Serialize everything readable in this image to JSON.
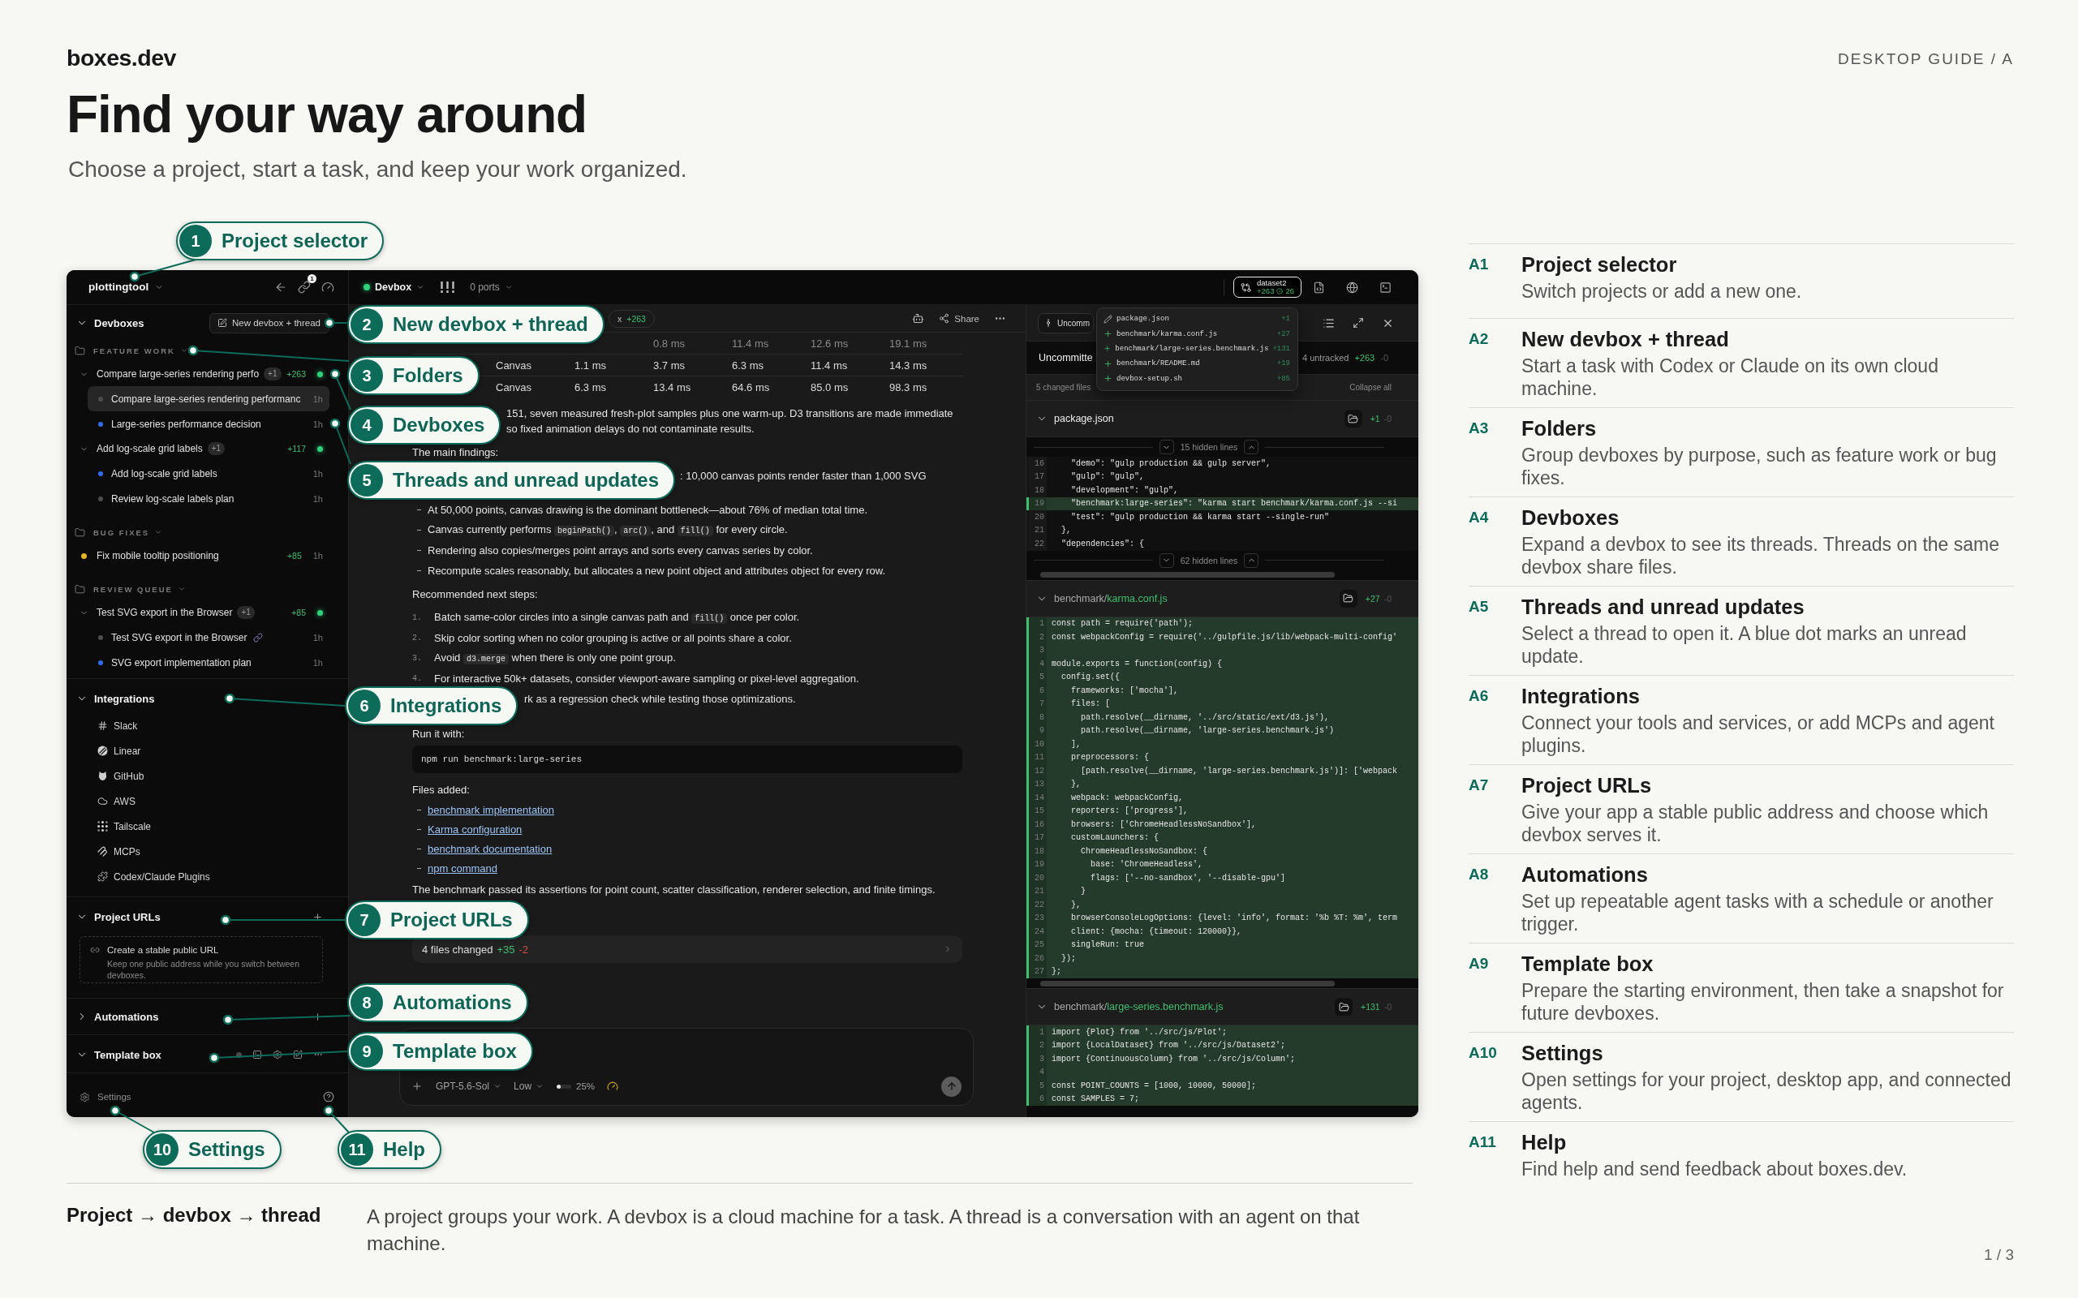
{
  "header": {
    "brand": "boxes.dev",
    "guide": "DESKTOP GUIDE / A",
    "title": "Find your way around",
    "subtitle": "Choose a project, start a task, and keep your work organized."
  },
  "app": {
    "sidebar": {
      "project": "plottingtool",
      "link_badge": "1",
      "sections": [
        {
          "kind": "devboxes",
          "title": "Devboxes",
          "expanded": true,
          "action": "New devbox + thread",
          "children": [
            {
              "label": "FEATURE WORK",
              "expanded": true,
              "children": [
                {
                  "kind": "devbox",
                  "label": "Compare large-series rendering perfo",
                  "expanded": true,
                  "badge": "+1",
                  "additions": "+263",
                  "online": true,
                  "children": [
                    {
                      "label": "Compare large-series rendering performanc",
                      "unread": false,
                      "selected": true,
                      "linked": false,
                      "time": "1h"
                    },
                    {
                      "label": "Large-series performance decision",
                      "unread": true,
                      "selected": false,
                      "linked": false,
                      "time": "1h"
                    }
                  ]
                },
                {
                  "kind": "devbox",
                  "label": "Add log-scale grid labels",
                  "expanded": true,
                  "badge": "+1",
                  "additions": "+117",
                  "online": true,
                  "children": [
                    {
                      "label": "Add log-scale grid labels",
                      "unread": true,
                      "selected": false,
                      "linked": false,
                      "time": "1h"
                    },
                    {
                      "label": "Review log-scale labels plan",
                      "unread": false,
                      "selected": false,
                      "linked": false,
                      "time": "1h"
                    }
                  ]
                }
              ]
            },
            {
              "label": "BUG FIXES",
              "expanded": true,
              "children": [
                {
                  "kind": "task",
                  "label": "Fix mobile tooltip positioning",
                  "color": "#e8b323",
                  "additions": "+85",
                  "time": "1h"
                }
              ]
            },
            {
              "label": "REVIEW QUEUE",
              "expanded": true,
              "children": [
                {
                  "kind": "devbox",
                  "label": "Test SVG export in the Browser",
                  "expanded": true,
                  "badge": "+1",
                  "additions": "+85",
                  "online": true,
                  "children": [
                    {
                      "label": "Test SVG export in the Browser",
                      "unread": false,
                      "selected": false,
                      "linked": true,
                      "time": "1h"
                    },
                    {
                      "label": "SVG export implementation plan",
                      "unread": true,
                      "selected": false,
                      "linked": false,
                      "time": "1h"
                    }
                  ]
                }
              ]
            }
          ]
        },
        {
          "kind": "integrations",
          "title": "Integrations",
          "expanded": true,
          "children": [
            {
              "label": "Slack"
            },
            {
              "label": "Linear"
            },
            {
              "label": "GitHub"
            },
            {
              "label": "AWS"
            },
            {
              "label": "Tailscale"
            },
            {
              "label": "MCPs"
            },
            {
              "label": "Codex/Claude Plugins"
            }
          ]
        },
        {
          "kind": "urls",
          "title": "Project URLs",
          "expanded": true,
          "card": {
            "title": "Create a stable public URL",
            "text": "Keep one public address while you switch between devboxes."
          }
        },
        {
          "kind": "automations",
          "title": "Automations",
          "expanded": false
        },
        {
          "kind": "template",
          "title": "Template box",
          "expanded": true
        }
      ],
      "settings": "Settings"
    },
    "topbar": {
      "devbox": "Devbox",
      "online": true,
      "ports": "0 ports",
      "branch": "dataset2",
      "additions": "+263",
      "commits": "26"
    },
    "thread": {
      "tab_text": "x",
      "tab_additions": "+263",
      "share": "Share",
      "table_rows": [
        {
          "cells": [
            "0.8 ms",
            "11.4 ms",
            "12.6 ms",
            "19.1 ms"
          ]
        },
        {
          "cells": [
            "Canvas",
            "1.1 ms",
            "3.7 ms",
            "6.3 ms",
            "11.4 ms",
            "14.3 ms"
          ]
        },
        {
          "cells": [
            "Canvas",
            "6.3 ms",
            "13.4 ms",
            "64.6 ms",
            "85.0 ms",
            "98.3 ms"
          ]
        }
      ],
      "blocks": [
        {
          "kind": "tail",
          "text": "151, seven measured fresh-plot samples plus one warm-up. D3 transitions are made immediate"
        },
        {
          "kind": "tail",
          "text": "so fixed animation delays do not contaminate results."
        },
        {
          "kind": "paragraph",
          "text": "The main findings:"
        },
        {
          "kind": "tail",
          "text": ": 10,000 canvas points render faster than 1,000 SVG"
        },
        {
          "kind": "bullets",
          "items": [
            {
              "parts": [
                {
                  "text": "At 50,000 points, canvas drawing is the dominant bottleneck—about 76% of median total time."
                }
              ]
            },
            {
              "parts": [
                {
                  "text": "Canvas currently performs "
                },
                {
                  "code": "beginPath()"
                },
                {
                  "text": ", "
                },
                {
                  "code": "arc()"
                },
                {
                  "text": ", and "
                },
                {
                  "code": "fill()"
                },
                {
                  "text": " for every circle."
                }
              ]
            },
            {
              "parts": [
                {
                  "text": "Rendering also copies/merges point arrays and sorts every canvas series by color."
                }
              ]
            },
            {
              "parts": [
                {
                  "text": "Recompute scales reasonably, but allocates a new point object and attributes object for every row."
                }
              ]
            }
          ]
        },
        {
          "kind": "paragraph",
          "text": "Recommended next steps:"
        },
        {
          "kind": "steps",
          "items": [
            {
              "number": "1.",
              "parts": [
                {
                  "text": "Batch same-color circles into a single canvas path and "
                },
                {
                  "code": "fill()"
                },
                {
                  "text": " once per color."
                }
              ]
            },
            {
              "number": "2.",
              "parts": [
                {
                  "text": "Skip color sorting when no color grouping is active or all points share a color."
                }
              ]
            },
            {
              "number": "3.",
              "parts": [
                {
                  "text": "Avoid "
                },
                {
                  "code": "d3.merge"
                },
                {
                  "text": " when there is only one point group."
                }
              ]
            },
            {
              "number": "4.",
              "parts": [
                {
                  "text": "For interactive 50k+ datasets, consider viewport-aware sampling or pixel-level aggregation."
                }
              ]
            }
          ]
        },
        {
          "kind": "tail",
          "text": "rk as a regression check while testing those optimizations."
        },
        {
          "kind": "paragraph",
          "text": "Run it with:"
        },
        {
          "kind": "code",
          "text": "npm run benchmark:large-series"
        },
        {
          "kind": "paragraph",
          "text": "Files added:"
        },
        {
          "kind": "links",
          "items": [
            "benchmark implementation",
            "Karma configuration",
            "benchmark documentation",
            "npm command"
          ]
        },
        {
          "kind": "paragraph",
          "text": "The benchmark passed its assertions for point count, scatter classification, renderer selection, and finite timings."
        }
      ],
      "changes": {
        "summary": "4 files changed",
        "additions": "+35",
        "deletions": "-2"
      },
      "composer": {
        "model": "GPT-5.6-Sol",
        "effort": "Low",
        "context": {
          "level": 0.25,
          "reading": "25%"
        }
      }
    },
    "diff": {
      "scope": "Uncomm",
      "title": "Uncommitte",
      "untracked": "4 untracked",
      "additions": "+263",
      "deletions": "-0",
      "changed": "5 changed files",
      "collapse": "Collapse all",
      "menu": [
        {
          "name": "package.json",
          "untracked": false,
          "additions": "+1"
        },
        {
          "name": "benchmark/karma.conf.js",
          "untracked": true,
          "additions": "+27"
        },
        {
          "name": "benchmark/large-series.benchmark.js",
          "untracked": true,
          "additions": "+131"
        },
        {
          "name": "benchmark/README.md",
          "untracked": true,
          "additions": "+19"
        },
        {
          "name": "devbox-setup.sh",
          "untracked": true,
          "additions": "+85"
        }
      ],
      "files": [
        {
          "name": "package.json",
          "untracked": false,
          "expanded": true,
          "additions": "+1",
          "deletions": "-0",
          "hunks": [
            {
              "kind": "hidden",
              "text": "15 hidden lines"
            },
            {
              "kind": "lines",
              "lines": [
                {
                  "number": "16",
                  "code": "    \"demo\": \"gulp production && gulp server\",",
                  "added": false
                },
                {
                  "number": "17",
                  "code": "    \"gulp\": \"gulp\",",
                  "added": false
                },
                {
                  "number": "18",
                  "code": "    \"development\": \"gulp\",",
                  "added": false
                },
                {
                  "number": "19",
                  "code": "    \"benchmark:large-series\": \"karma start benchmark/karma.conf.js --si",
                  "added": true
                },
                {
                  "number": "20",
                  "code": "    \"test\": \"gulp production && karma start --single-run\"",
                  "added": false
                },
                {
                  "number": "21",
                  "code": "  },",
                  "added": false
                },
                {
                  "number": "22",
                  "code": "  \"dependencies\": {",
                  "added": false
                }
              ]
            },
            {
              "kind": "hidden",
              "text": "62 hidden lines"
            }
          ]
        },
        {
          "dir": "benchmark/",
          "name": "karma.conf.js",
          "untracked": true,
          "expanded": true,
          "additions": "+27",
          "deletions": "-0",
          "hunks": [
            {
              "kind": "lines",
              "lines": [
                {
                  "number": "1",
                  "code": "const path = require('path');",
                  "added": true
                },
                {
                  "number": "2",
                  "code": "const webpackConfig = require('../gulpfile.js/lib/webpack-multi-config'",
                  "added": true
                },
                {
                  "number": "3",
                  "added": true
                },
                {
                  "number": "4",
                  "code": "module.exports = function(config) {",
                  "added": true
                },
                {
                  "number": "5",
                  "code": "  config.set({",
                  "added": true
                },
                {
                  "number": "6",
                  "code": "    frameworks: ['mocha'],",
                  "added": true
                },
                {
                  "number": "7",
                  "code": "    files: [",
                  "added": true
                },
                {
                  "number": "8",
                  "code": "      path.resolve(__dirname, '../src/static/ext/d3.js'),",
                  "added": true
                },
                {
                  "number": "9",
                  "code": "      path.resolve(__dirname, 'large-series.benchmark.js')",
                  "added": true
                },
                {
                  "number": "10",
                  "code": "    ],",
                  "added": true
                },
                {
                  "number": "11",
                  "code": "    preprocessors: {",
                  "added": true
                },
                {
                  "number": "12",
                  "code": "      [path.resolve(__dirname, 'large-series.benchmark.js')]: ['webpack",
                  "added": true
                },
                {
                  "number": "13",
                  "code": "    },",
                  "added": true
                },
                {
                  "number": "14",
                  "code": "    webpack: webpackConfig,",
                  "added": true
                },
                {
                  "number": "15",
                  "code": "    reporters: ['progress'],",
                  "added": true
                },
                {
                  "number": "16",
                  "code": "    browsers: ['ChromeHeadlessNoSandbox'],",
                  "added": true
                },
                {
                  "number": "17",
                  "code": "    customLaunchers: {",
                  "added": true
                },
                {
                  "number": "18",
                  "code": "      ChromeHeadlessNoSandbox: {",
                  "added": true
                },
                {
                  "number": "19",
                  "code": "        base: 'ChromeHeadless',",
                  "added": true
                },
                {
                  "number": "20",
                  "code": "        flags: ['--no-sandbox', '--disable-gpu']",
                  "added": true
                },
                {
                  "number": "21",
                  "code": "      }",
                  "added": true
                },
                {
                  "number": "22",
                  "code": "    },",
                  "added": true
                },
                {
                  "number": "23",
                  "code": "    browserConsoleLogOptions: {level: 'info', format: '%b %T: %m', term",
                  "added": true
                },
                {
                  "number": "24",
                  "code": "    client: {mocha: {timeout: 120000}},",
                  "added": true
                },
                {
                  "number": "25",
                  "code": "    singleRun: true",
                  "added": true
                },
                {
                  "number": "26",
                  "code": "  });",
                  "added": true
                },
                {
                  "number": "27",
                  "code": "};",
                  "added": true
                }
              ]
            }
          ]
        },
        {
          "dir": "benchmark/",
          "name": "large-series.benchmark.js",
          "untracked": true,
          "expanded": true,
          "additions": "+131",
          "deletions": "-0",
          "hunks": [
            {
              "kind": "lines",
              "lines": [
                {
                  "number": "1",
                  "code": "import {Plot} from '../src/js/Plot';",
                  "added": true
                },
                {
                  "number": "2",
                  "code": "import {LocalDataset} from '../src/js/Dataset2';",
                  "added": true
                },
                {
                  "number": "3",
                  "code": "import {ContinuousColumn} from '../src/js/Column';",
                  "added": true
                },
                {
                  "number": "4",
                  "added": true
                },
                {
                  "number": "5",
                  "code": "const POINT_COUNTS = [1000, 10000, 50000];",
                  "added": true
                },
                {
                  "number": "6",
                  "code": "const SAMPLES = 7;",
                  "added": true
                }
              ]
            }
          ]
        }
      ]
    }
  },
  "callouts": [
    {
      "number": "1",
      "label": "Project selector"
    },
    {
      "number": "2",
      "label": "New devbox + thread"
    },
    {
      "number": "3",
      "label": "Folders"
    },
    {
      "number": "4",
      "label": "Devboxes"
    },
    {
      "number": "5",
      "label": "Threads and unread updates"
    },
    {
      "number": "6",
      "label": "Integrations"
    },
    {
      "number": "7",
      "label": "Project URLs"
    },
    {
      "number": "8",
      "label": "Automations"
    },
    {
      "number": "9",
      "label": "Template box"
    },
    {
      "number": "10",
      "label": "Settings"
    },
    {
      "number": "11",
      "label": "Help"
    }
  ],
  "legend": [
    {
      "code": "A1",
      "title": "Project selector",
      "description": "Switch projects or add a new one."
    },
    {
      "code": "A2",
      "title": "New devbox + thread",
      "description": "Start a task with Codex or Claude on its own cloud machine."
    },
    {
      "code": "A3",
      "title": "Folders",
      "description": "Group devboxes by purpose, such as feature work or bug fixes."
    },
    {
      "code": "A4",
      "title": "Devboxes",
      "description": "Expand a devbox to see its threads. Threads on the same devbox share files."
    },
    {
      "code": "A5",
      "title": "Threads and unread updates",
      "description": "Select a thread to open it. A blue dot marks an unread update."
    },
    {
      "code": "A6",
      "title": "Integrations",
      "description": "Connect your tools and services, or add MCPs and agent plugins."
    },
    {
      "code": "A7",
      "title": "Project URLs",
      "description": "Give your app a stable public address and choose which devbox serves it."
    },
    {
      "code": "A8",
      "title": "Automations",
      "description": "Set up repeatable agent tasks with a schedule or another trigger."
    },
    {
      "code": "A9",
      "title": "Template box",
      "description": "Prepare the starting environment, then take a snapshot for future devboxes."
    },
    {
      "code": "A10",
      "title": "Settings",
      "description": "Open settings for your project, desktop app, and connected agents."
    },
    {
      "code": "A11",
      "title": "Help",
      "description": "Find help and send feedback about boxes.dev."
    }
  ],
  "footer": {
    "title": "Project → devbox → thread",
    "text": "A project groups your work. A devbox is a cloud machine for a task. A thread is a conversation with an agent on that machine.",
    "page": "1 / 3"
  }
}
